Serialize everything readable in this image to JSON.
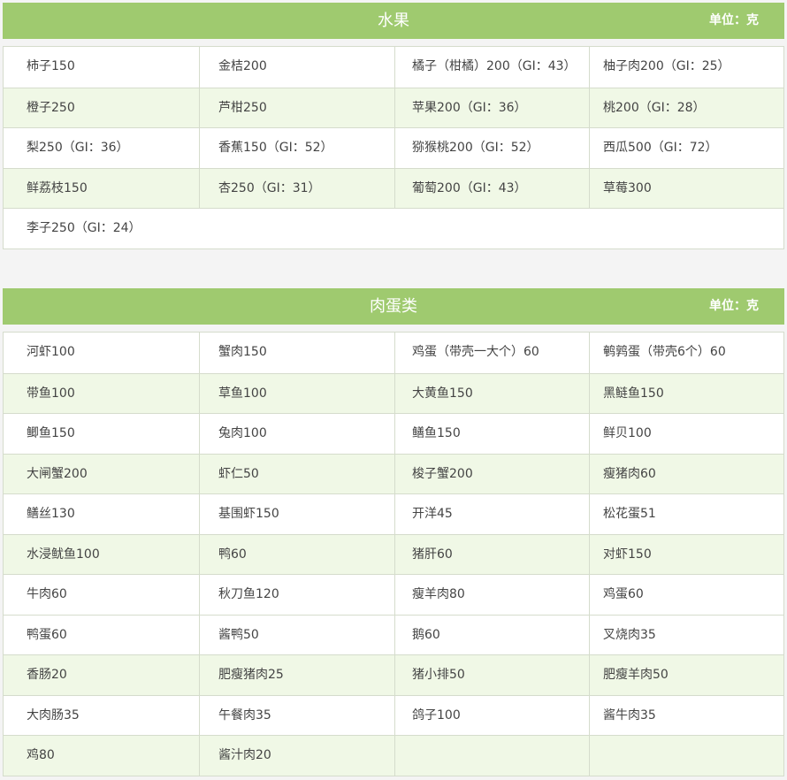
{
  "fruit": {
    "title": "水果",
    "unit": "单位：克",
    "rows": [
      [
        "柿子150",
        "金桔200",
        "橘子（柑橘）200（GI：43）",
        "柚子肉200（GI：25）"
      ],
      [
        "橙子250",
        "芦柑250",
        "苹果200（GI：36）",
        "桃200（GI：28）"
      ],
      [
        "梨250（GI：36）",
        "香蕉150（GI：52）",
        "猕猴桃200（GI：52）",
        "西瓜500（GI：72）"
      ],
      [
        "鲜荔枝150",
        "杏250（GI：31）",
        "葡萄200（GI：43）",
        "草莓300"
      ],
      [
        "李子250（GI：24）"
      ]
    ]
  },
  "meat": {
    "title": "肉蛋类",
    "unit": "单位：克",
    "rows": [
      [
        "河虾100",
        "蟹肉150",
        "鸡蛋（带壳一大个）60",
        "鹌鹑蛋（带壳6个）60"
      ],
      [
        "带鱼100",
        "草鱼100",
        "大黄鱼150",
        "黑鲢鱼150"
      ],
      [
        "鲫鱼150",
        "兔肉100",
        "鳝鱼150",
        "鲜贝100"
      ],
      [
        "大闸蟹200",
        "虾仁50",
        "梭子蟹200",
        "瘦猪肉60"
      ],
      [
        "鳝丝130",
        "基围虾150",
        "开洋45",
        "松花蛋51"
      ],
      [
        "水浸鱿鱼100",
        "鸭60",
        "猪肝60",
        "对虾150"
      ],
      [
        "牛肉60",
        "秋刀鱼120",
        "瘦羊肉80",
        "鸡蛋60"
      ],
      [
        "鸭蛋60",
        "酱鸭50",
        "鹅60",
        "叉烧肉35"
      ],
      [
        "香肠20",
        "肥瘦猪肉25",
        "猪小排50",
        "肥瘦羊肉50"
      ],
      [
        "大肉肠35",
        "午餐肉35",
        "鸽子100",
        "酱牛肉35"
      ],
      [
        "鸡80",
        "酱汁肉20",
        "",
        ""
      ]
    ]
  },
  "colors": {
    "header_bg": "#9fca6f",
    "alt_row_bg": "#f0f8e6",
    "border": "#d5dccc"
  }
}
